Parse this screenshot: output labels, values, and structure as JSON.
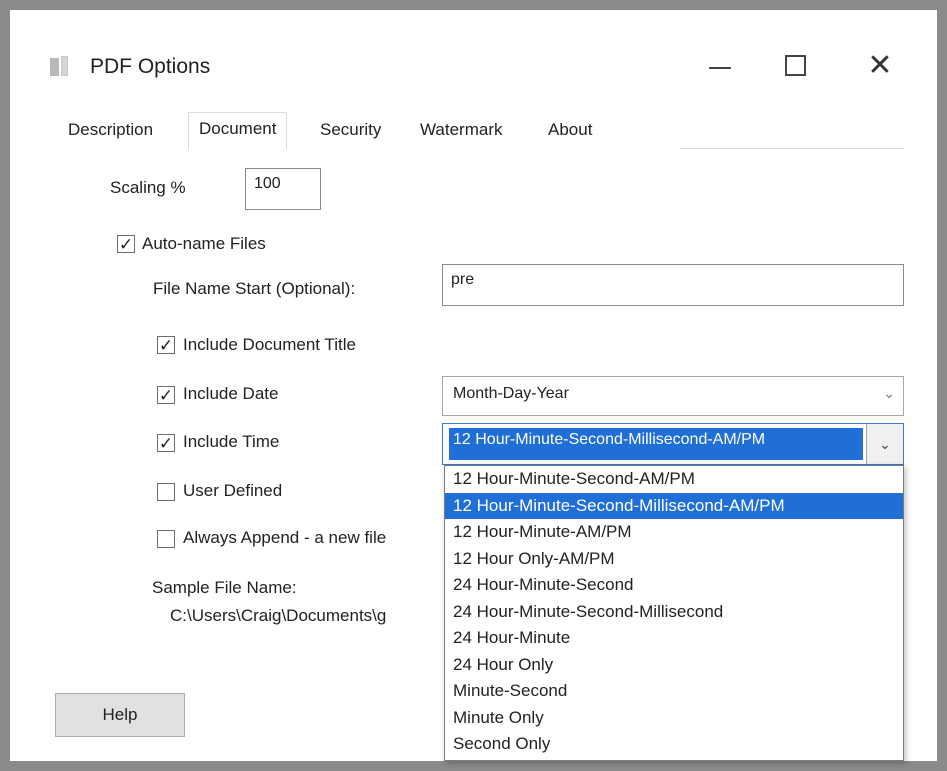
{
  "window": {
    "title": "PDF Options",
    "minimize_glyph": "",
    "close_glyph": "✕"
  },
  "tabs": [
    {
      "label": "Description",
      "active": false
    },
    {
      "label": "Document",
      "active": true
    },
    {
      "label": "Security",
      "active": false
    },
    {
      "label": "Watermark",
      "active": false
    },
    {
      "label": "About",
      "active": false
    }
  ],
  "scaling": {
    "label": "Scaling %",
    "value": "100"
  },
  "auto_name": {
    "label": "Auto-name Files",
    "checked": true
  },
  "file_name_start": {
    "label": "File Name Start (Optional):",
    "value": "pre"
  },
  "include_title": {
    "label": "Include Document Title",
    "checked": true
  },
  "include_date": {
    "label": "Include Date",
    "checked": true,
    "value": "Month-Day-Year"
  },
  "include_time": {
    "label": "Include Time",
    "checked": true,
    "value": "12 Hour-Minute-Second-Millisecond-AM/PM"
  },
  "user_defined": {
    "label": "User Defined",
    "checked": false
  },
  "always_append": {
    "label": "Always Append - a new file",
    "checked": false
  },
  "sample": {
    "label": "Sample File Name:",
    "value": "C:\\Users\\Craig\\Documents\\g"
  },
  "time_options": [
    "12 Hour-Minute-Second-AM/PM",
    "12 Hour-Minute-Second-Millisecond-AM/PM",
    "12 Hour-Minute-AM/PM",
    "12 Hour Only-AM/PM",
    "24 Hour-Minute-Second",
    "24 Hour-Minute-Second-Millisecond",
    "24 Hour-Minute",
    "24 Hour Only",
    "Minute-Second",
    "Minute Only",
    "Second Only"
  ],
  "time_selected_index": 1,
  "help_button": "Help",
  "check_glyph": "✓",
  "chevron_glyph": "⌄",
  "colors": {
    "selection": "#1f6fd6",
    "background": "#ffffff"
  }
}
